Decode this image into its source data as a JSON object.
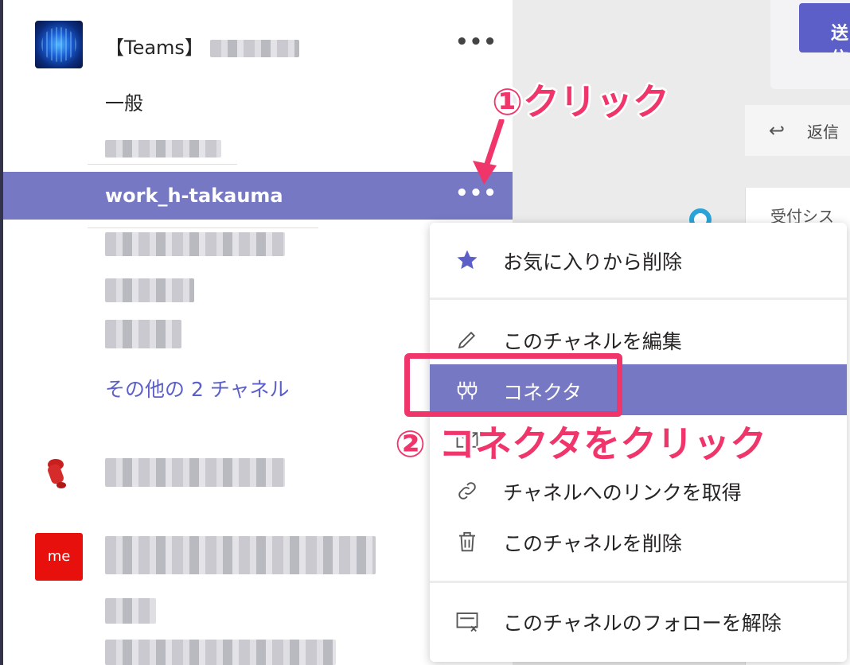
{
  "team": {
    "name": "【Teams】",
    "more_label": "•••"
  },
  "channels": {
    "general": "一般",
    "selected": "work_h-takauma",
    "more_channels": "その他の 2 チャネル"
  },
  "team3": {
    "avatar_text": "me"
  },
  "right_pane": {
    "send_label": "送信",
    "reply_label": "返信",
    "card_title": "受付シス"
  },
  "menu": {
    "items": [
      {
        "label": "お気に入りから削除",
        "icon": "star-icon"
      },
      {
        "label": "このチャネルを編集",
        "icon": "pencil-icon"
      },
      {
        "label": "コネクタ",
        "icon": "connector-plug-icon"
      },
      {
        "label": "チャネルへのリンクを取得",
        "icon": "link-icon"
      },
      {
        "label": "このチャネルを削除",
        "icon": "trash-icon"
      },
      {
        "label": "このチャネルのフォローを解除",
        "icon": "unfollow-icon"
      }
    ]
  },
  "annotations": {
    "step1": "①クリック",
    "step2": "② コネクタをクリック"
  },
  "colors": {
    "accent": "#7678c3",
    "brand": "#5b5fc7",
    "annotation": "#f0356b"
  }
}
